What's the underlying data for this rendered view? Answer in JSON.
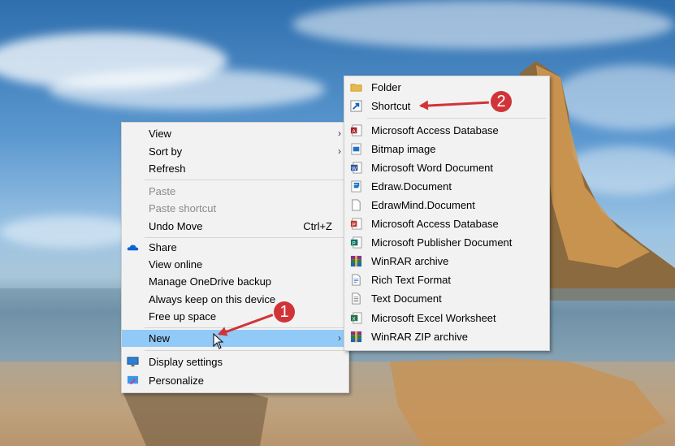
{
  "context_menu": {
    "items": [
      {
        "label": "View",
        "submenu": true
      },
      {
        "label": "Sort by",
        "submenu": true
      },
      {
        "label": "Refresh"
      },
      {
        "label": "Paste",
        "disabled": true
      },
      {
        "label": "Paste shortcut",
        "disabled": true
      },
      {
        "label": "Undo Move",
        "shortcut": "Ctrl+Z"
      },
      {
        "label": "Share"
      },
      {
        "label": "View online"
      },
      {
        "label": "Manage OneDrive backup"
      },
      {
        "label": "Always keep on this device"
      },
      {
        "label": "Free up space"
      },
      {
        "label": "New",
        "submenu": true,
        "highlighted": true
      },
      {
        "label": "Display settings"
      },
      {
        "label": "Personalize"
      }
    ]
  },
  "new_submenu": {
    "items": [
      {
        "label": "Folder",
        "icon": "folder-icon"
      },
      {
        "label": "Shortcut",
        "icon": "shortcut-icon"
      },
      {
        "label": "Microsoft Access Database",
        "icon": "access-icon"
      },
      {
        "label": "Bitmap image",
        "icon": "bitmap-icon"
      },
      {
        "label": "Microsoft Word Document",
        "icon": "word-icon"
      },
      {
        "label": "Edraw.Document",
        "icon": "edraw-icon"
      },
      {
        "label": "EdrawMind.Document",
        "icon": "blank-document-icon"
      },
      {
        "label": "Microsoft Access Database",
        "icon": "access-icon"
      },
      {
        "label": "Microsoft Publisher Document",
        "icon": "publisher-icon"
      },
      {
        "label": "WinRAR archive",
        "icon": "winrar-icon"
      },
      {
        "label": "Rich Text Format",
        "icon": "rtf-icon"
      },
      {
        "label": "Text Document",
        "icon": "text-document-icon"
      },
      {
        "label": "Microsoft Excel Worksheet",
        "icon": "excel-icon"
      },
      {
        "label": "WinRAR ZIP archive",
        "icon": "winrar-zip-icon"
      }
    ]
  },
  "annotations": {
    "step1": "1",
    "step2": "2"
  },
  "colors": {
    "highlight": "#91c9f7",
    "annotation_red": "#d13438"
  }
}
